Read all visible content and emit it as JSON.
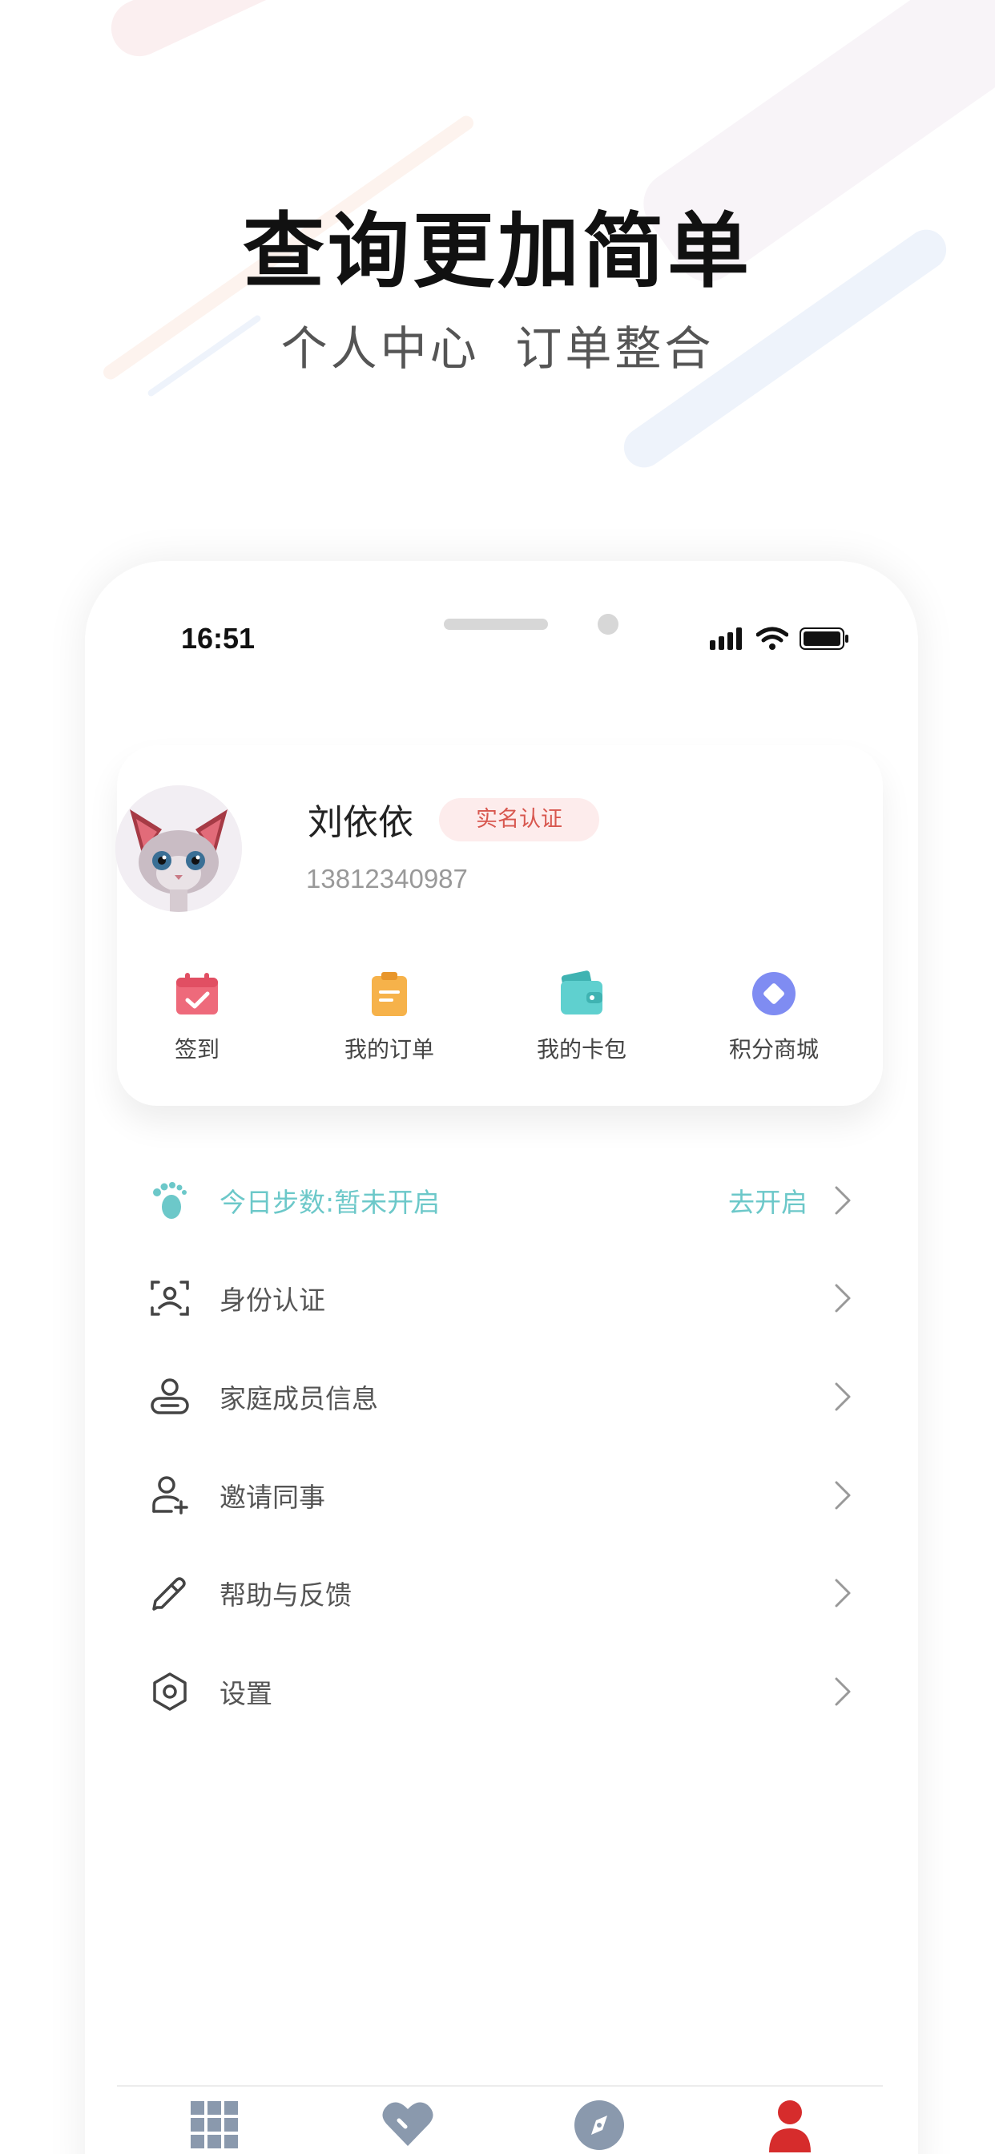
{
  "headline": {
    "title": "查询更加简单",
    "subtitle": "个人中心  订单整合"
  },
  "status_bar": {
    "time": "16:51"
  },
  "profile": {
    "name": "刘依依",
    "verify_badge": "实名认证",
    "phone": "13812340987"
  },
  "quick_actions": [
    {
      "label": "签到",
      "icon": "calendar-check-icon",
      "color": "#ee6a7b"
    },
    {
      "label": "我的订单",
      "icon": "clipboard-icon",
      "color": "#f6b24a"
    },
    {
      "label": "我的卡包",
      "icon": "wallet-icon",
      "color": "#5fd0cf"
    },
    {
      "label": "积分商城",
      "icon": "diamond-icon",
      "color": "#7f8cf2"
    }
  ],
  "menu": {
    "steps": {
      "label": "今日步数:暂未开启",
      "action": "去开启",
      "icon": "footprint-icon"
    },
    "items": [
      {
        "label": "身份认证",
        "icon": "id-scan-icon"
      },
      {
        "label": "家庭成员信息",
        "icon": "family-icon"
      },
      {
        "label": "邀请同事",
        "icon": "add-user-icon"
      },
      {
        "label": "帮助与反馈",
        "icon": "pencil-icon"
      },
      {
        "label": "设置",
        "icon": "settings-hex-icon"
      }
    ]
  },
  "tabbar": {
    "tabs": [
      {
        "icon": "grid-icon"
      },
      {
        "icon": "heart-icon"
      },
      {
        "icon": "compass-icon"
      },
      {
        "icon": "person-icon",
        "active": true
      }
    ]
  },
  "colors": {
    "accent": "#6cc8c9",
    "badge_text": "#d8574f",
    "badge_bg": "#fdecec",
    "tab_inactive": "#8a99ad",
    "tab_active": "#d62c2c"
  }
}
